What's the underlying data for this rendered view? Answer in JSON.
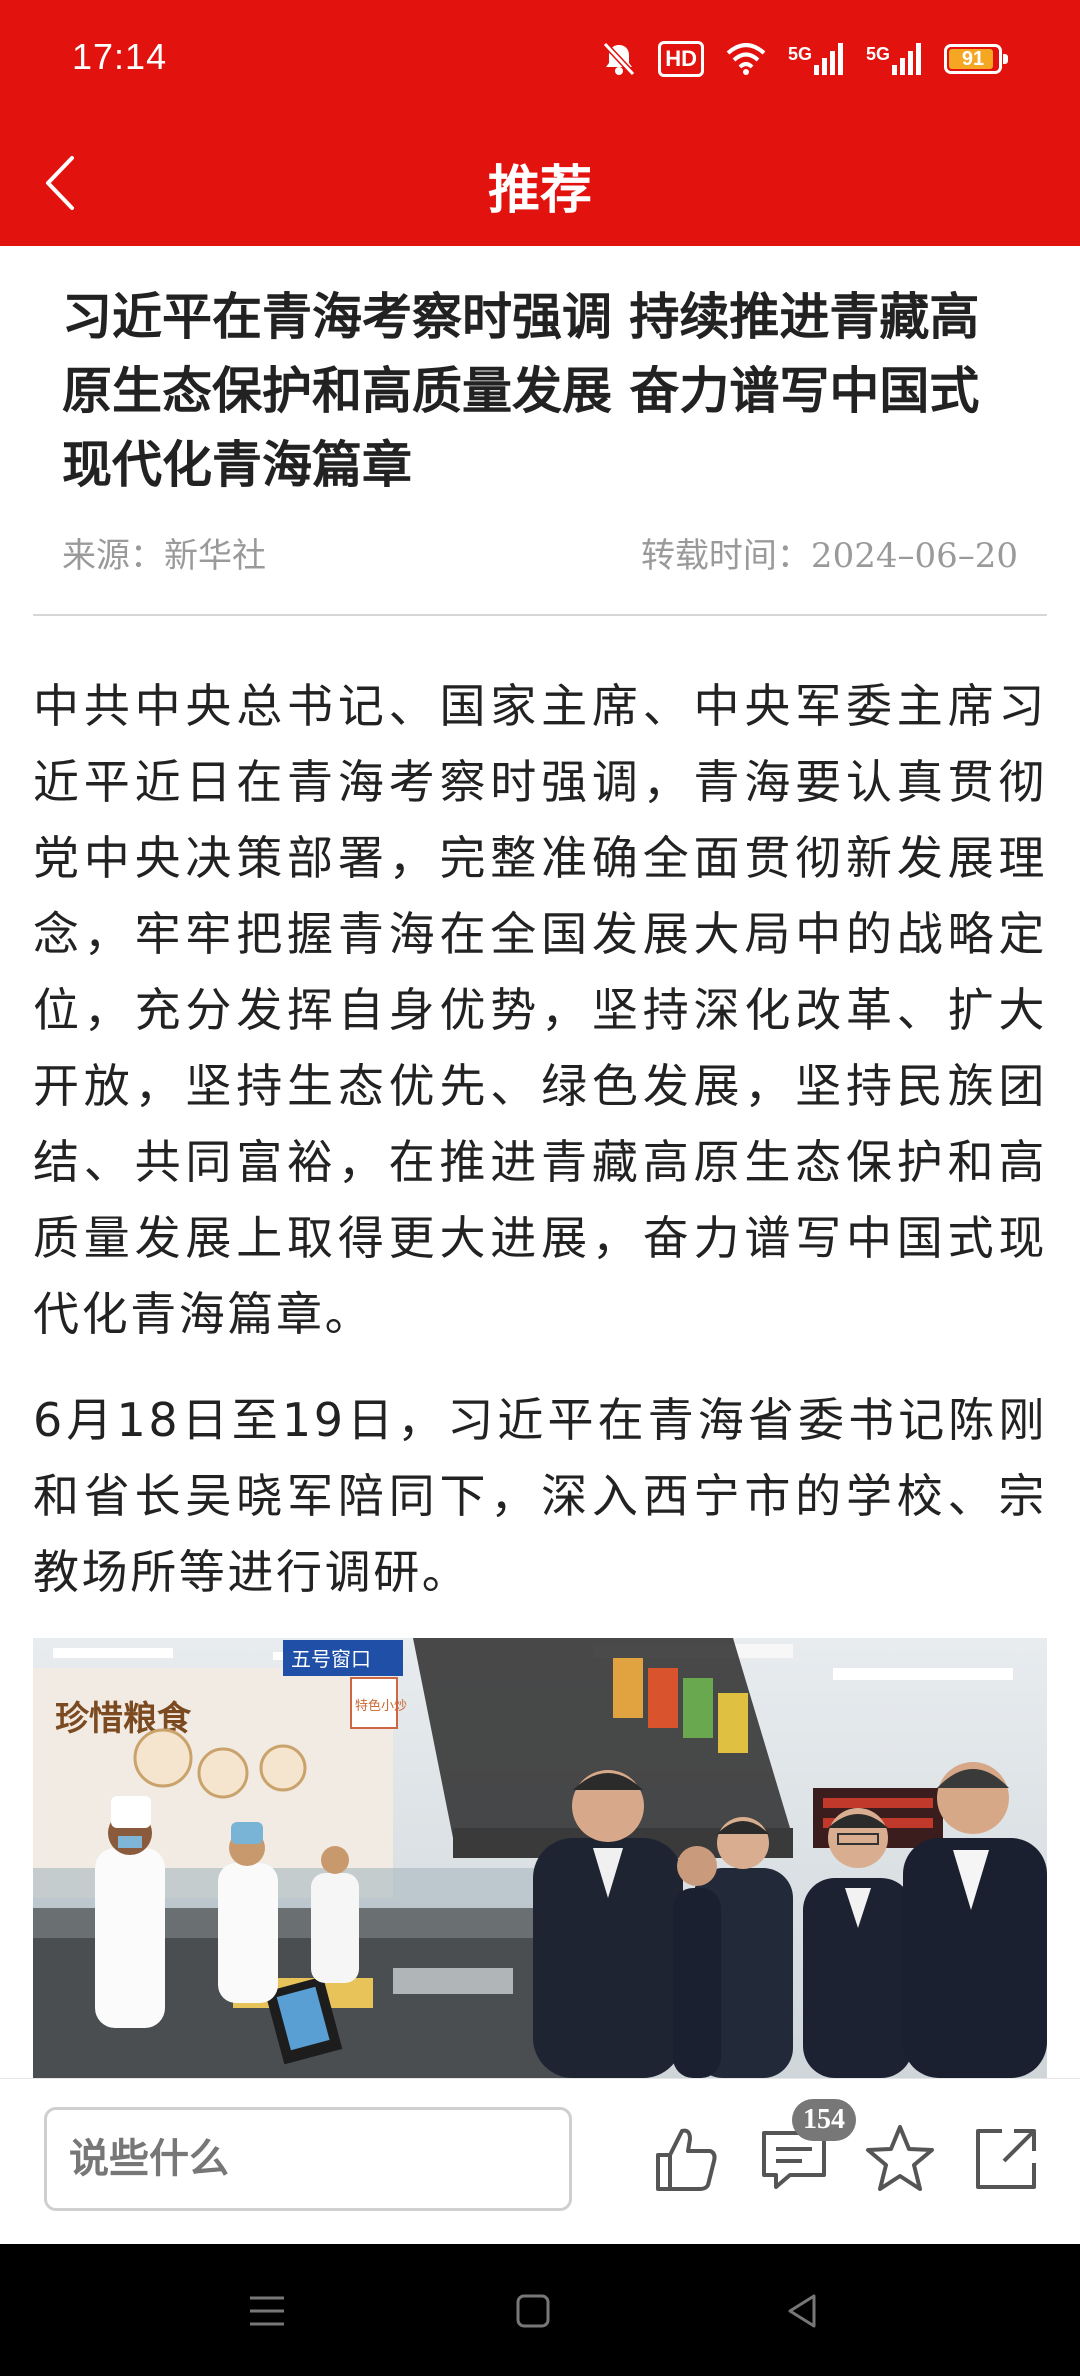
{
  "status_bar": {
    "time": "17:14",
    "hd_label": "HD",
    "signal1_label": "5G",
    "signal2_label": "5G",
    "battery_level": "91",
    "battery_fraction": 0.91,
    "icons": [
      "mute-bell-icon",
      "hd-icon",
      "wifi-icon",
      "signal-5g-icon",
      "signal-5g-icon",
      "battery-icon"
    ]
  },
  "header": {
    "title": "推荐",
    "back_icon": "chevron-left-icon",
    "background": "#e2120f"
  },
  "article": {
    "title": "习近平在青海考察时强调 持续推进青藏高原生态保护和高质量发展 奋力谱写中国式现代化青海篇章",
    "source": "来源：新华社",
    "repost_time": "转载时间：2024–06–20",
    "paragraphs": [
      "中共中央总书记、国家主席、中央军委主席习近平近日在青海考察时强调，青海要认真贯彻党中央决策部署，完整准确全面贯彻新发展理念，牢牢把握青海在全国发展大局中的战略定位，充分发挥自身优势，坚持深化改革、扩大开放，坚持生态优先、绿色发展，坚持民族团结、共同富裕，在推进青藏高原生态保护和高质量发展上取得更大进展，奋力谱写中国式现代化青海篇章。",
      "6月18日至19日，习近平在青海省委书记陈刚和省长吴晓军陪同下，深入西宁市的学校、宗教场所等进行调研。"
    ],
    "photo_signs": {
      "sign_left": "珍惜粮食",
      "sign_top": "五号窗口",
      "sign_sub": "特色小炒"
    }
  },
  "bottom_bar": {
    "comment_placeholder": "说些什么",
    "comment_count": "154",
    "actions": [
      "like-icon",
      "comment-icon",
      "star-icon",
      "share-icon"
    ]
  },
  "nav_bar": {
    "buttons": [
      "menu-icon",
      "home-icon",
      "back-triangle-icon"
    ]
  }
}
